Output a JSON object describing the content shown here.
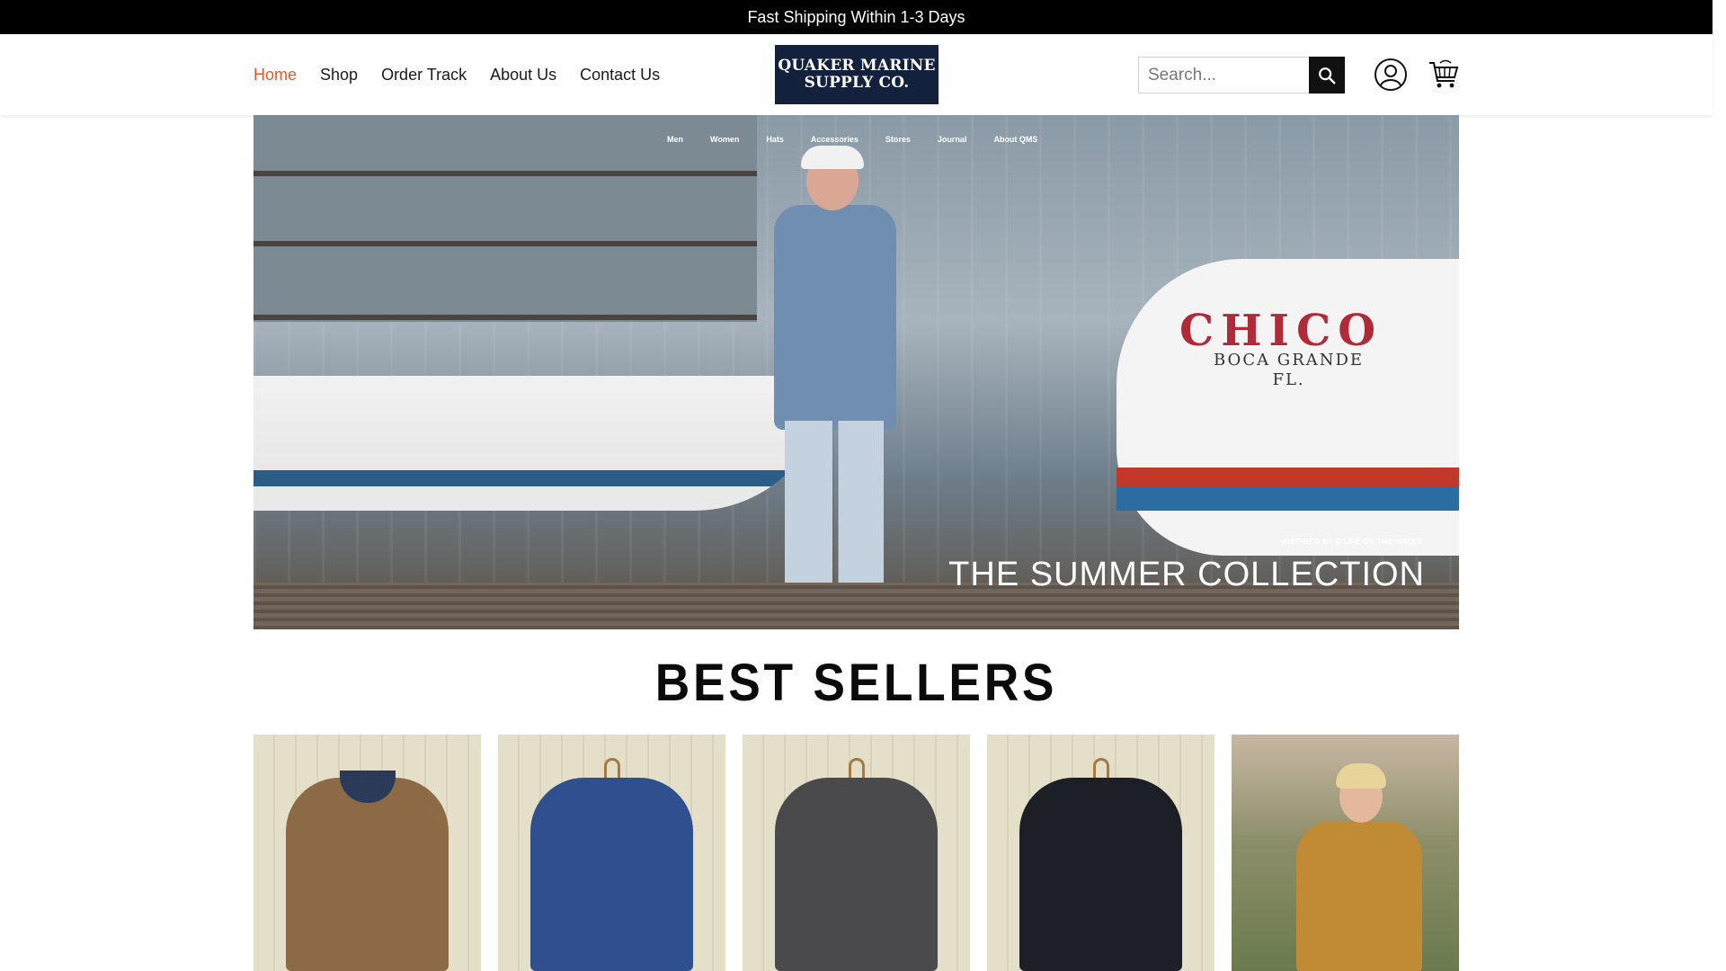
{
  "announcement": "Fast Shipping Within 1-3 Days",
  "nav": {
    "home": "Home",
    "shop": "Shop",
    "order_track": "Order Track",
    "about": "About Us",
    "contact": "Contact Us",
    "active_color": "#e4572e"
  },
  "logo": {
    "line1": "QUAKER MARINE",
    "line2": "SUPPLY CO.",
    "bg_color": "#14213d"
  },
  "search": {
    "placeholder": "Search..."
  },
  "icons": {
    "search": "search-icon",
    "account": "user-circle-icon",
    "cart": "shopping-cart-icon"
  },
  "hero": {
    "nav": [
      "Men",
      "Women",
      "Hats",
      "Accessories",
      "Stores",
      "Journal",
      "About QMS"
    ],
    "boat_name": "CHICO",
    "boat_home_line1": "BOCA GRANDE",
    "boat_home_line2": "FL.",
    "tagline": "INSPIRED BY A LIFE ON THE WATER",
    "title": "THE SUMMER COLLECTION"
  },
  "best_sellers": {
    "title": "BEST SELLERS",
    "products": [
      {
        "name": "tweed-sport-coat",
        "color": "#8b6a45"
      },
      {
        "name": "navy-peacoat",
        "color": "#2f4f8f"
      },
      {
        "name": "charcoal-shirt-jacket",
        "color": "#4a4a4c"
      },
      {
        "name": "black-shirt-jacket",
        "color": "#1c1f26"
      },
      {
        "name": "tan-field-jacket",
        "color": "#c18a35"
      }
    ]
  }
}
